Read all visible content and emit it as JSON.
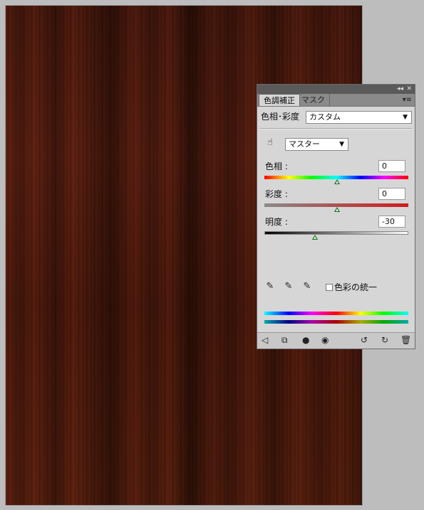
{
  "panel": {
    "tabs": [
      "色調補正",
      "マスク"
    ],
    "adjustment_label": "色相･彩度",
    "preset": "カスタム",
    "channel": "マスター",
    "hue": {
      "label": "色相 :",
      "value": "0",
      "level": 0.5
    },
    "saturation": {
      "label": "彩度 :",
      "value": "0",
      "level": 0.5
    },
    "lightness": {
      "label": "明度 :",
      "value": "-30",
      "level": 0.35
    },
    "colorize_label": "色彩の統一",
    "colorize_checked": false
  },
  "icons": {
    "titlebar": [
      "collapse-icon",
      "close-icon"
    ],
    "bottom": [
      "back-arrow-icon",
      "clip-layer-icon",
      "toggle-mask-icon",
      "eye-icon",
      "view-previous-icon",
      "reset-icon",
      "trash-icon"
    ]
  }
}
